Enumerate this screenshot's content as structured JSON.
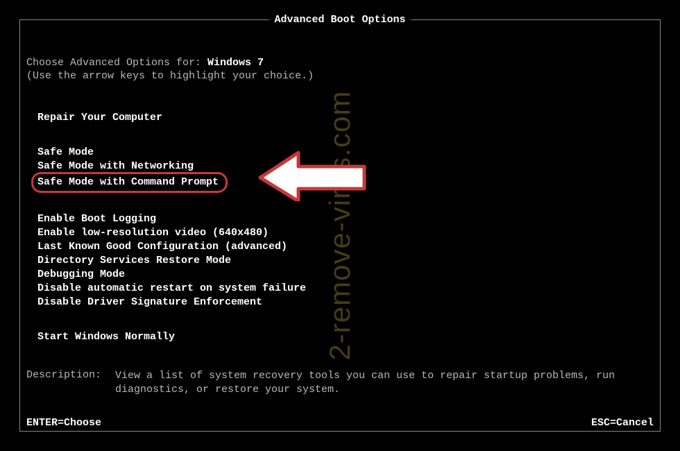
{
  "title": "Advanced Boot Options",
  "choose_prefix": "Choose Advanced Options for: ",
  "os_name": "Windows 7",
  "hint": "(Use the arrow keys to highlight your choice.)",
  "groups": {
    "repair": "Repair Your Computer",
    "safe": [
      "Safe Mode",
      "Safe Mode with Networking",
      "Safe Mode with Command Prompt"
    ],
    "advanced": [
      "Enable Boot Logging",
      "Enable low-resolution video (640x480)",
      "Last Known Good Configuration (advanced)",
      "Directory Services Restore Mode",
      "Debugging Mode",
      "Disable automatic restart on system failure",
      "Disable Driver Signature Enforcement"
    ],
    "normal": "Start Windows Normally"
  },
  "description": {
    "label": "Description:",
    "text": "View a list of system recovery tools you can use to repair startup problems, run diagnostics, or restore your system."
  },
  "footer": {
    "enter": "ENTER=Choose",
    "esc": "ESC=Cancel"
  },
  "watermark": "2-remove-virus.com"
}
